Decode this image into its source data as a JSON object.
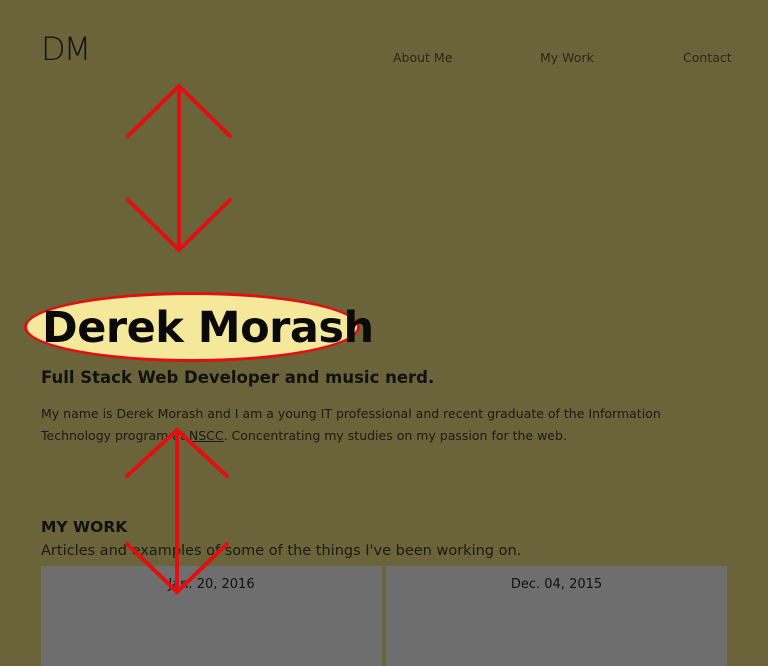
{
  "header": {
    "logo": "DM",
    "nav": [
      "About Me",
      "My Work",
      "Contact"
    ]
  },
  "hero": {
    "name": "Derek Morash",
    "subtitle": "Full Stack Web Developer and music nerd.",
    "intro_line1": "My name is Derek Morash and I am a young IT professional and recent graduate of the Information",
    "intro_line2_prefix": "Technology program at ",
    "intro_link": "NSCC",
    "intro_line2_suffix": ". Concentrating my studies on my passion for the web."
  },
  "work": {
    "title": "MY WORK",
    "description": "Articles and examples of some of the things I've been working on.",
    "cards": [
      {
        "date": "Jan. 20, 2016"
      },
      {
        "date": "Dec. 04, 2015"
      }
    ]
  },
  "colors": {
    "background": "#6b643b",
    "highlight": "#f5e89a",
    "annotation": "#e01010",
    "card": "#6e6e6e"
  }
}
